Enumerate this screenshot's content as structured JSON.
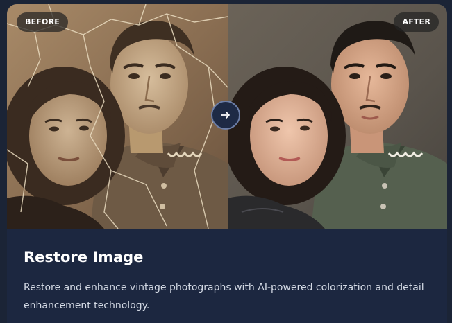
{
  "badges": {
    "before": "BEFORE",
    "after": "AFTER"
  },
  "card": {
    "title": "Restore Image",
    "description": "Restore and enhance vintage photographs with AI-powered colorization and detail enhancement technology."
  },
  "icons": {
    "compare_arrow": "arrow-right-icon"
  },
  "colors": {
    "page_bg": "#1b2436",
    "card_bg": "#1c2740",
    "title_text": "#ffffff",
    "body_text": "#d3d9e4",
    "arrow_ring": "#6d7fa8"
  }
}
